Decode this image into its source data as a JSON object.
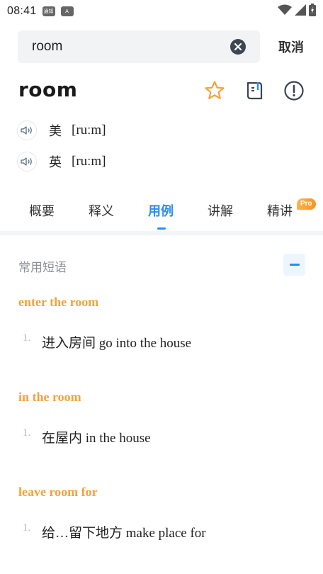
{
  "status_bar": {
    "time": "08:41",
    "mini_icon_1": "通知",
    "mini_icon_2": "A",
    "icons": [
      "wifi-icon",
      "signal-icon",
      "battery-icon"
    ]
  },
  "search": {
    "value": "room",
    "placeholder": "",
    "cancel_label": "取消"
  },
  "word": {
    "headword": "room",
    "actions": [
      "star-icon",
      "wordbook-icon",
      "report-icon"
    ],
    "pronunciations": [
      {
        "region": "美",
        "phonetic": "[ruːm]"
      },
      {
        "region": "英",
        "phonetic": "[ruːm]"
      }
    ]
  },
  "tabs": [
    {
      "label": "概要",
      "active": false
    },
    {
      "label": "释义",
      "active": false
    },
    {
      "label": "用例",
      "active": true
    },
    {
      "label": "讲解",
      "active": false
    },
    {
      "label": "精讲",
      "active": false,
      "badge": "Pro"
    }
  ],
  "section": {
    "title": "常用短语",
    "phrases": [
      {
        "phrase": "enter the room",
        "examples": [
          {
            "num": "1.",
            "text": "进入房间 go into the house"
          }
        ]
      },
      {
        "phrase": "in the room",
        "examples": [
          {
            "num": "1.",
            "text": "在屋内 in the house"
          }
        ]
      },
      {
        "phrase": "leave room for",
        "examples": [
          {
            "num": "1.",
            "text": "给…留下地方 make place for"
          }
        ]
      }
    ]
  },
  "colors": {
    "accent": "#2b8df5",
    "phrase": "#f5a23a",
    "star": "#f5a23a",
    "muted": "#8c8f95"
  }
}
